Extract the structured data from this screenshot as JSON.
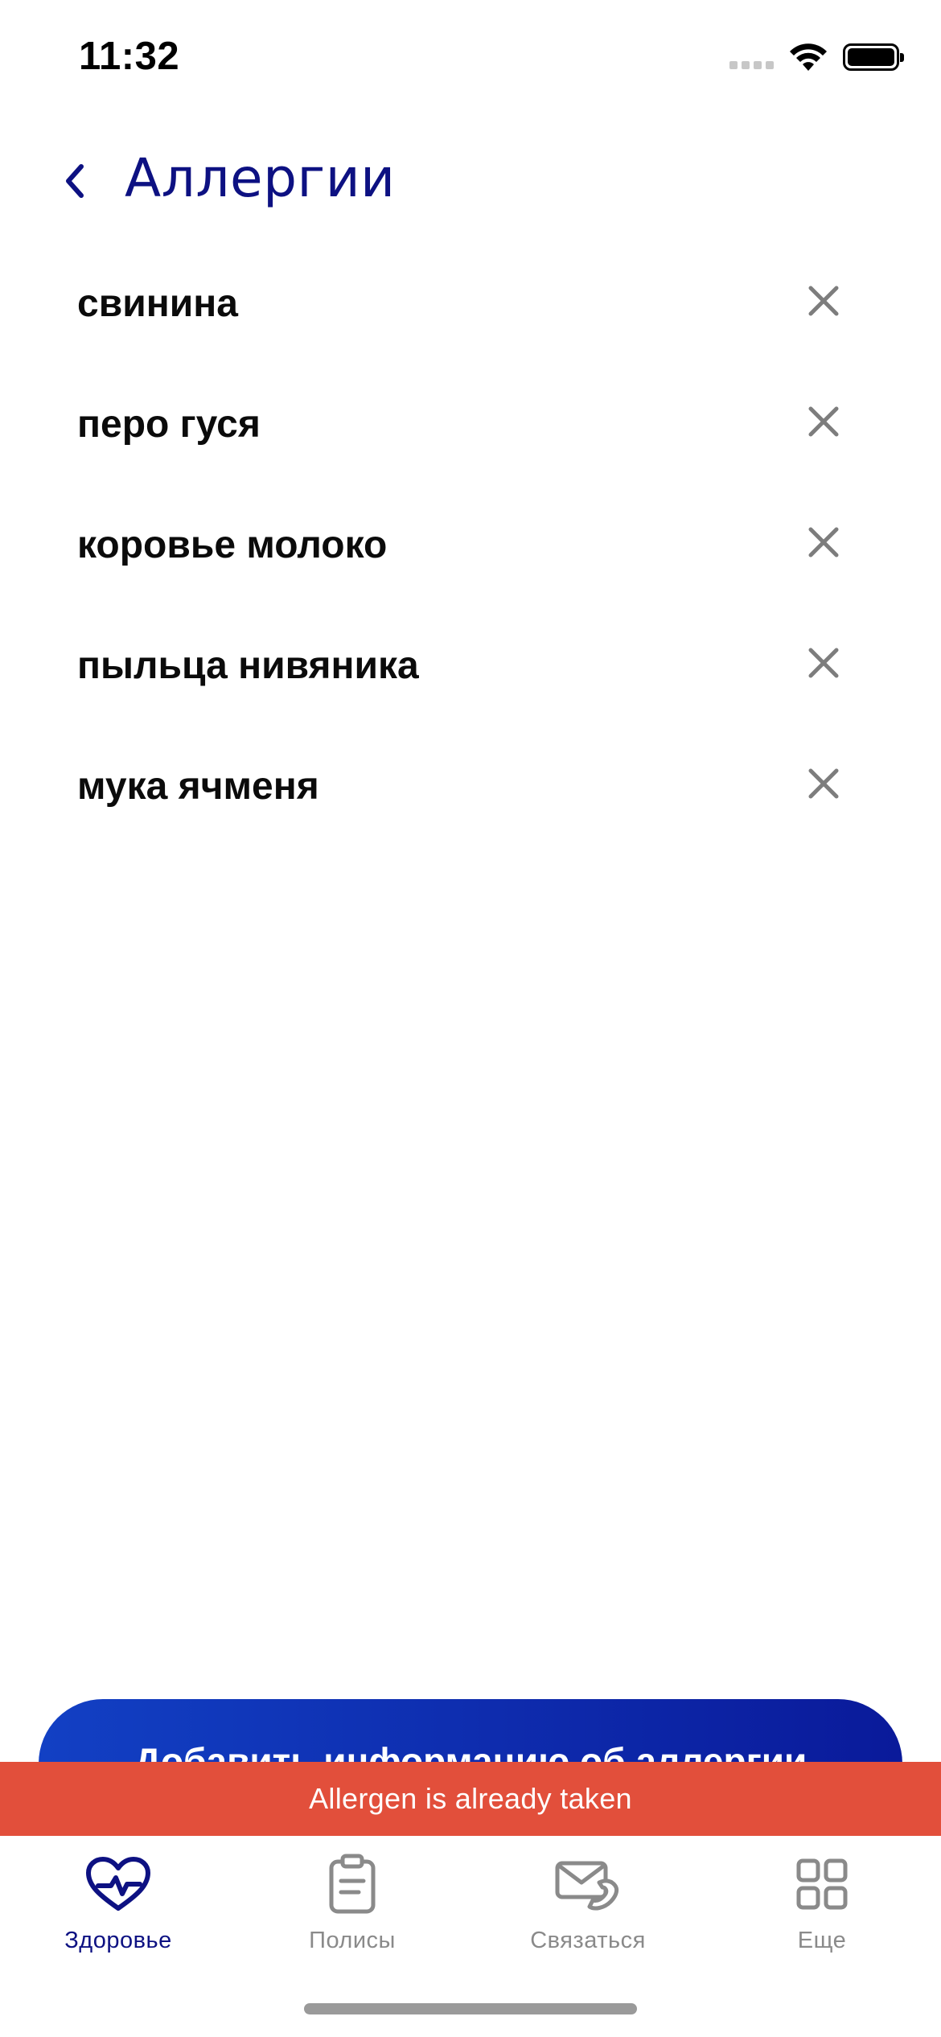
{
  "status_bar": {
    "time": "11:32"
  },
  "header": {
    "title": "Аллергии"
  },
  "allergies": [
    {
      "label": "свинина"
    },
    {
      "label": "перо гуся"
    },
    {
      "label": "коровье молоко"
    },
    {
      "label": "пыльца нивяника"
    },
    {
      "label": "мука ячменя"
    }
  ],
  "add_button": {
    "label": "Добавить информацию об аллергии"
  },
  "toast": {
    "message": "Allergen is already taken"
  },
  "tabbar": {
    "tabs": [
      {
        "label": "Здоровье",
        "icon": "heart-pulse-icon",
        "active": true
      },
      {
        "label": "Полисы",
        "icon": "clipboard-icon",
        "active": false
      },
      {
        "label": "Связаться",
        "icon": "mail-phone-icon",
        "active": false
      },
      {
        "label": "Еще",
        "icon": "grid-icon",
        "active": false
      }
    ]
  },
  "colors": {
    "primary": "#0d1182",
    "toast_bg": "#e24f3b",
    "button_gradient_start": "#1240c4",
    "button_gradient_end": "#0a1a9a",
    "inactive": "#8a8a8a"
  }
}
